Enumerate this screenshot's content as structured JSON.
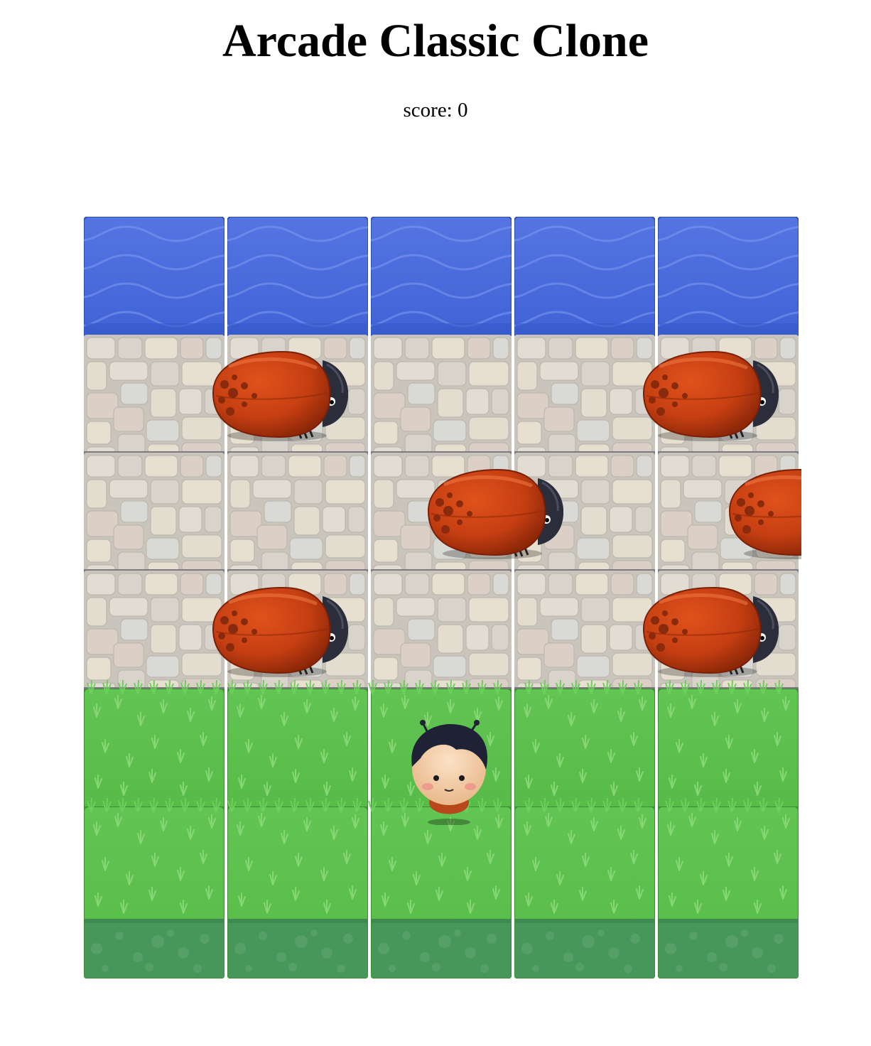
{
  "header": {
    "title": "Arcade Classic Clone",
    "score_label": "score:",
    "score_value": "0"
  },
  "board": {
    "columns": 5,
    "rows": 6,
    "row_types": [
      "water",
      "stone",
      "stone",
      "stone",
      "grass",
      "grass"
    ],
    "colors": {
      "water": "#4a6fdc",
      "stone": "#dcd8cf",
      "grass": "#5ec24e",
      "soil": "#46965a"
    }
  },
  "enemies": [
    {
      "name": "enemy-bug",
      "row": 1,
      "col": 1.0
    },
    {
      "name": "enemy-bug",
      "row": 1,
      "col": 4.0
    },
    {
      "name": "enemy-bug",
      "row": 2,
      "col": 2.5
    },
    {
      "name": "enemy-bug",
      "row": 2,
      "col": 4.6
    },
    {
      "name": "enemy-bug",
      "row": 3,
      "col": 1.0
    },
    {
      "name": "enemy-bug",
      "row": 3,
      "col": 4.0
    }
  ],
  "player": {
    "name": "player-character",
    "row": 4,
    "col": 2
  }
}
